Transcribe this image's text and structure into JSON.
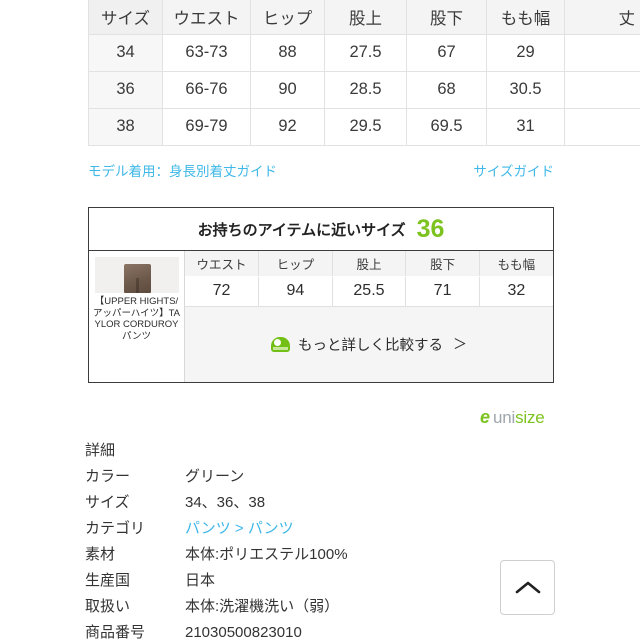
{
  "size_table": {
    "headers": [
      "サイズ",
      "ウエスト",
      "ヒップ",
      "股上",
      "股下",
      "もも幅",
      "丈"
    ],
    "rows": [
      [
        "34",
        "63-73",
        "88",
        "27.5",
        "67",
        "29",
        ""
      ],
      [
        "36",
        "66-76",
        "90",
        "28.5",
        "68",
        "30.5",
        ""
      ],
      [
        "38",
        "69-79",
        "92",
        "29.5",
        "69.5",
        "31",
        ""
      ]
    ]
  },
  "guide_links": {
    "model_guide": "モデル着用：身長別着丈ガイド",
    "size_guide": "サイズガイド"
  },
  "unisize": {
    "head_label": "お持ちのアイテムに近いサイズ",
    "head_size": "36",
    "item_caption": "【UPPER HIGHTS/アッパーハイツ】TAYLOR CORDUROY パンツ",
    "headers": [
      "ウエスト",
      "ヒップ",
      "股上",
      "股下",
      "もも幅"
    ],
    "values": [
      "72",
      "94",
      "25.5",
      "71",
      "32"
    ],
    "compare_link": "もっと詳しく比較する",
    "compare_chevron": "＞",
    "logo_mark": "e",
    "logo_word_a": "uni",
    "logo_word_b": "size",
    "green": "#7dc320"
  },
  "details": {
    "title": "詳細",
    "rows": [
      {
        "label": "カラー",
        "value": "グリーン",
        "is_link": false
      },
      {
        "label": "サイズ",
        "value": "34、36、38",
        "is_link": false
      },
      {
        "label": "カテゴリ",
        "value": "パンツ > パンツ",
        "is_link": true
      },
      {
        "label": "素材",
        "value": "本体:ポリエステル100%",
        "is_link": false
      },
      {
        "label": "生産国",
        "value": "日本",
        "is_link": false
      },
      {
        "label": "取扱い",
        "value": "本体:洗濯機洗い（弱）",
        "is_link": false
      },
      {
        "label": "商品番号",
        "value": "21030500823010",
        "is_link": false
      }
    ]
  },
  "scroll_top": {
    "name": "ページトップへ戻る"
  }
}
